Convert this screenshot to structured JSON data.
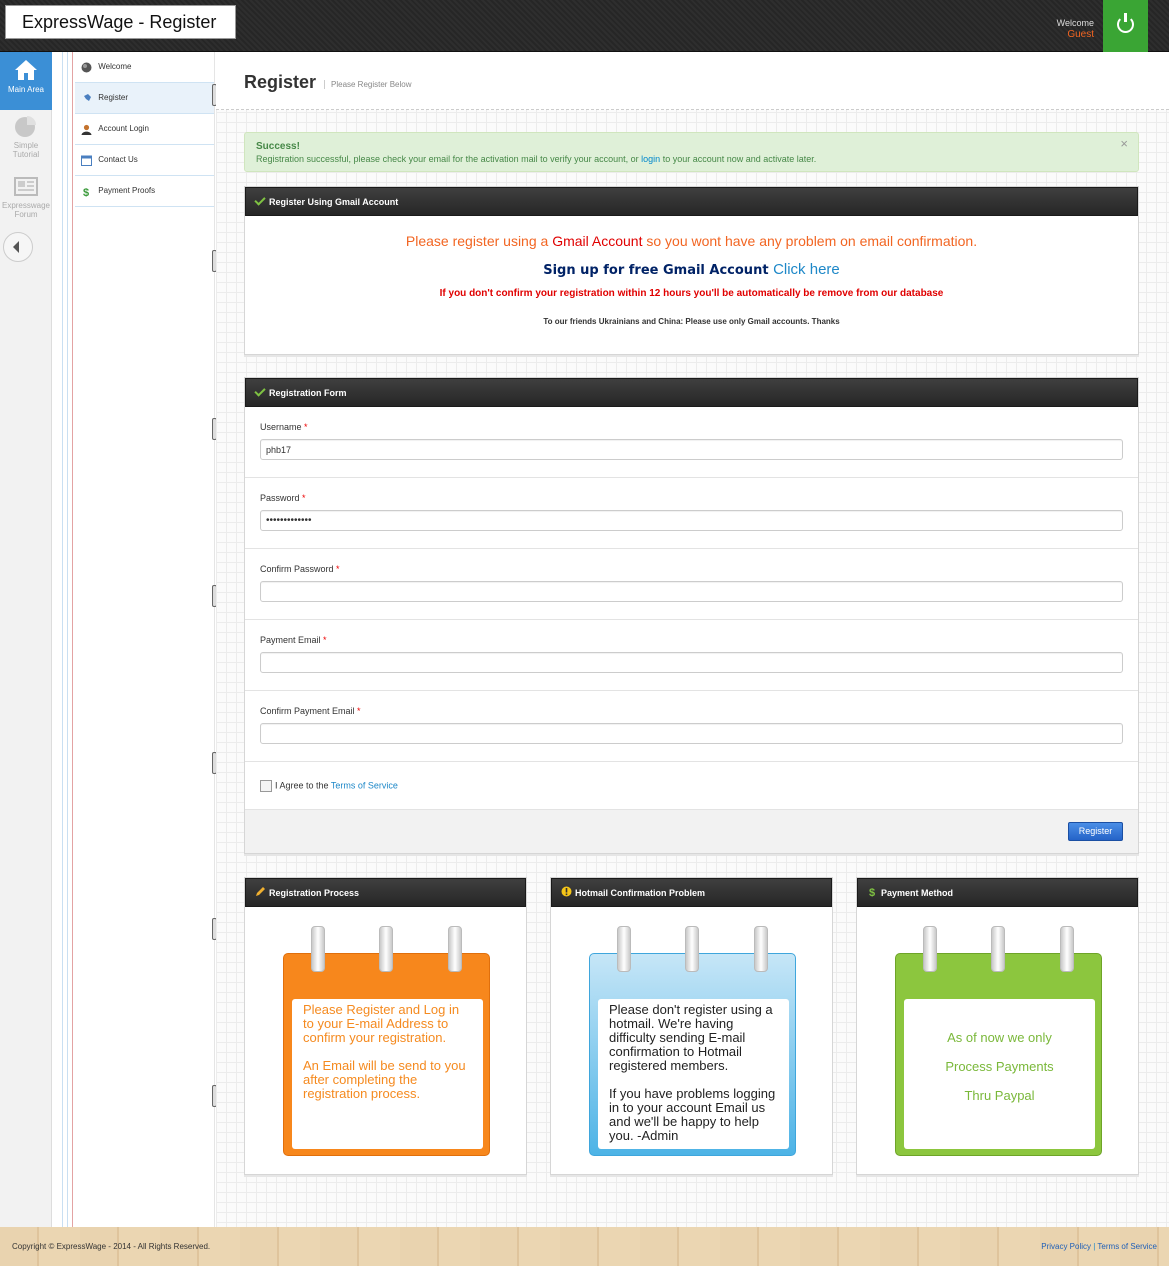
{
  "header": {
    "app_title": "ExpressWage - Register",
    "welcome": "Welcome",
    "user": "Guest"
  },
  "rail": {
    "items": [
      {
        "label": "Main Area"
      },
      {
        "label": "Simple Tutorial"
      },
      {
        "label": "Expresswage Forum"
      }
    ]
  },
  "nav": {
    "items": [
      {
        "label": "Welcome"
      },
      {
        "label": "Register"
      },
      {
        "label": "Account Login"
      },
      {
        "label": "Contact Us"
      },
      {
        "label": "Payment Proofs"
      }
    ]
  },
  "page": {
    "title": "Register",
    "subtitle": "Please Register Below"
  },
  "alert": {
    "title": "Success!",
    "text_before": "Registration successful, please check your email for the activation mail to verify your account, or ",
    "link": "login",
    "text_after": " to your account now and activate later.",
    "close": "×"
  },
  "gmail": {
    "header": "Register Using Gmail Account",
    "line1_a": "Please register using a ",
    "line1_b": "Gmail Account",
    "line1_c": " so you wont have any problem on email confirmation.",
    "line2": "Sign up for free Gmail Account ",
    "line2_link": "Click here",
    "line3": "If you don't confirm your registration within 12 hours you'll be automatically be remove from our database",
    "line4": "To our friends Ukrainians and China:  Please use only Gmail accounts.  Thanks"
  },
  "form": {
    "header": "Registration Form",
    "username_label": "Username",
    "username_value": "phb17",
    "password_label": "Password",
    "password_value": "•••••••••••••",
    "confirm_password_label": "Confirm Password",
    "payment_email_label": "Payment Email",
    "confirm_payment_email_label": "Confirm Payment Email",
    "required_mark": "*",
    "agree_text": "I Agree to the ",
    "tos_link": "Terms of Service",
    "register_button": "Register"
  },
  "cards": {
    "process": {
      "header": "Registration Process",
      "p1": "Please Register and Log in to your E-mail Address to confirm your registration.",
      "p2": "An Email will be send to you after completing the registration process."
    },
    "hotmail": {
      "header": "Hotmail Confirmation Problem",
      "p1": "Please don't register using a hotmail. We're having difficulty sending E-mail confirmation to Hotmail registered members.",
      "p2": "If you have problems logging in to your account Email us and we'll be happy to help you. -Admin"
    },
    "payment": {
      "header": "Payment Method",
      "l1": "As of now we only",
      "l2": "Process Payments",
      "l3": "Thru Paypal"
    }
  },
  "footer": {
    "copyright": "Copyright © ExpressWage - 2014 - All Rights Reserved.",
    "privacy": "Privacy Policy",
    "separator": " | ",
    "terms": "Terms of Service"
  },
  "colors": {
    "accent_blue": "#3b8fd6",
    "success_bg": "#dff0d8",
    "warning_red": "#e00000",
    "orange": "#f26522",
    "green_ribbon": "#3aa534"
  }
}
